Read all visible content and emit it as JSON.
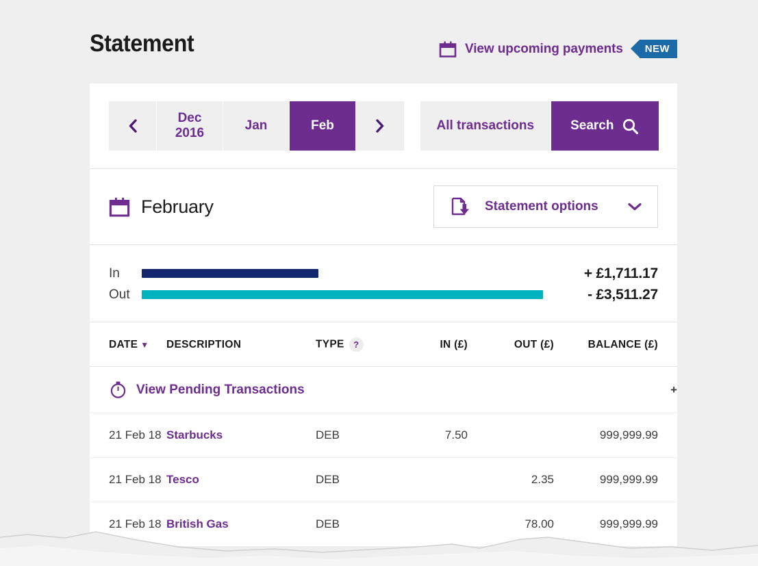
{
  "header": {
    "title": "Statement",
    "upcoming_label": "View upcoming payments",
    "upcoming_icon": "calendar-icon",
    "new_badge": "NEW"
  },
  "nav": {
    "prev_icon": "chevron-left-icon",
    "next_icon": "chevron-right-icon",
    "months": [
      {
        "label": "Dec",
        "sublabel": "2016",
        "active": false
      },
      {
        "label": "Jan",
        "sublabel": "",
        "active": false
      },
      {
        "label": "Feb",
        "sublabel": "",
        "active": true
      }
    ],
    "all_transactions_label": "All transactions",
    "search_label": "Search",
    "search_icon": "search-icon"
  },
  "month_section": {
    "icon": "calendar-icon",
    "title": "February",
    "options_label": "Statement options",
    "options_icon": "document-download-icon",
    "options_chevron": "chevron-down-icon"
  },
  "summary": {
    "in_label": "In",
    "out_label": "Out",
    "in_amount": "+ £1,711.17",
    "out_amount": "- £3,511.27",
    "in_color": "#14276e",
    "out_color": "#00b3be",
    "in_bar_pct": 44,
    "out_bar_pct": 100
  },
  "table": {
    "columns": {
      "date": "DATE",
      "description": "DESCRIPTION",
      "type": "TYPE",
      "in": "IN (£)",
      "out": "OUT (£)",
      "balance": "BALANCE (£)"
    },
    "sort_caret": "▼",
    "type_help": "?",
    "pending": {
      "label": "View Pending Transactions",
      "icon": "stopwatch-icon",
      "expand": "+"
    },
    "rows": [
      {
        "date": "21 Feb 18",
        "description": "Starbucks",
        "type": "DEB",
        "in": "7.50",
        "out": "",
        "balance": "999,999.99"
      },
      {
        "date": "21 Feb 18",
        "description": "Tesco",
        "type": "DEB",
        "in": "",
        "out": "2.35",
        "balance": "999,999.99"
      },
      {
        "date": "21 Feb 18",
        "description": "British Gas",
        "type": "DEB",
        "in": "",
        "out": "78.00",
        "balance": "999,999.99"
      }
    ]
  },
  "theme": {
    "brand_purple": "#6d2d8f",
    "badge_blue": "#1a6aa8",
    "page_bg": "#efefef"
  }
}
